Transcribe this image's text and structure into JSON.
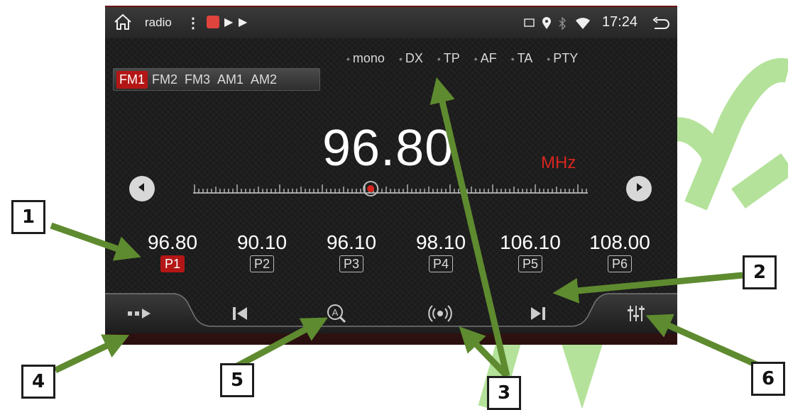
{
  "status": {
    "title": "radio",
    "time": "17:24",
    "icons": [
      "home-icon",
      "more-icon",
      "app-icon",
      "play-icon",
      "play-icon",
      "cast-icon",
      "location-icon",
      "bluetooth-icon",
      "wifi-icon",
      "back-icon"
    ]
  },
  "bands": [
    "FM1",
    "FM2",
    "FM3",
    "AM1",
    "AM2"
  ],
  "active_band": "FM1",
  "flags": [
    "mono",
    "DX",
    "TP",
    "AF",
    "TA",
    "PTY"
  ],
  "frequency": "96.80",
  "unit": "MHz",
  "tuner_position": 0.45,
  "presets": [
    {
      "freq": "96.80",
      "label": "P1",
      "active": true
    },
    {
      "freq": "90.10",
      "label": "P2",
      "active": false
    },
    {
      "freq": "96.10",
      "label": "P3",
      "active": false
    },
    {
      "freq": "98.10",
      "label": "P4",
      "active": false
    },
    {
      "freq": "106.10",
      "label": "P5",
      "active": false
    },
    {
      "freq": "108.00",
      "label": "P6",
      "active": false
    }
  ],
  "toolbar": [
    "source-icon",
    "previous-icon",
    "auto-search-icon",
    "radio-broadcast-icon",
    "next-icon",
    "equalizer-icon"
  ],
  "callouts": [
    "1",
    "2",
    "3",
    "4",
    "5",
    "6"
  ],
  "colors": {
    "accent": "#b41616",
    "unit": "#d9251f",
    "arrow": "#5e8b2f",
    "watermark": "#b4e29a"
  }
}
